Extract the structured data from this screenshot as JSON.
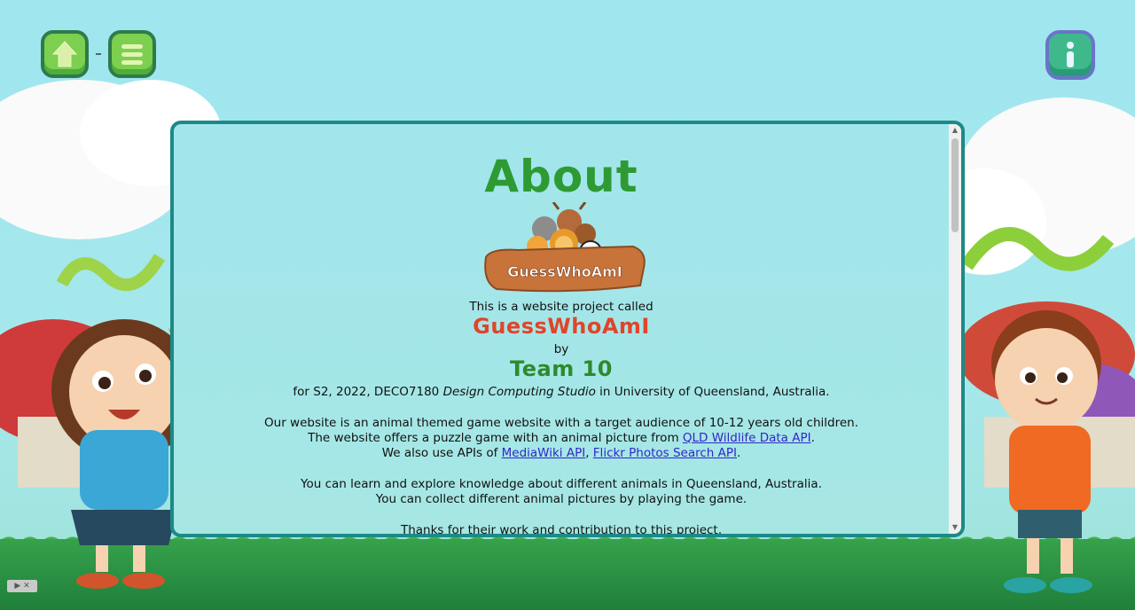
{
  "nav": {
    "home_icon": "home-icon",
    "menu_icon": "menu-icon",
    "info_icon": "info-icon"
  },
  "about": {
    "title": "About",
    "logo_text": "GuessWhoAmI",
    "intro": "This is a website project called",
    "brand": "GuessWhoAmI",
    "by": "by",
    "team": "Team 10",
    "course_prefix": "for S2, 2022, DECO7180 ",
    "course_name": "Design Computing Studio",
    "course_suffix": " in University of Queensland, Australia.",
    "p1_line1": "Our website is an animal themed game website with a target audience of 10-12 years old children.",
    "p1_line2_prefix": "The website offers a puzzle game with an animal picture from ",
    "p1_line2_link": "QLD Wildlife Data API",
    "p1_line2_suffix": ".",
    "p1_line3_prefix": "We also use APIs of ",
    "p1_line3_link1": "MediaWiki API",
    "p1_line3_sep": ", ",
    "p1_line3_link2": "Flickr Photos Search API",
    "p1_line3_suffix": ".",
    "p2_line1": "You can learn and explore knowledge about different animals in Queensland, Australia.",
    "p2_line2": "You can collect different animal pictures by playing the game.",
    "p3_line1": "Thanks for their work and contribution to this project,"
  },
  "colors": {
    "title_green": "#2e9a34",
    "brand_red": "#e0452b",
    "team_green": "#2e8a2c",
    "panel_border": "#1c8a86",
    "link": "#3326c9"
  }
}
